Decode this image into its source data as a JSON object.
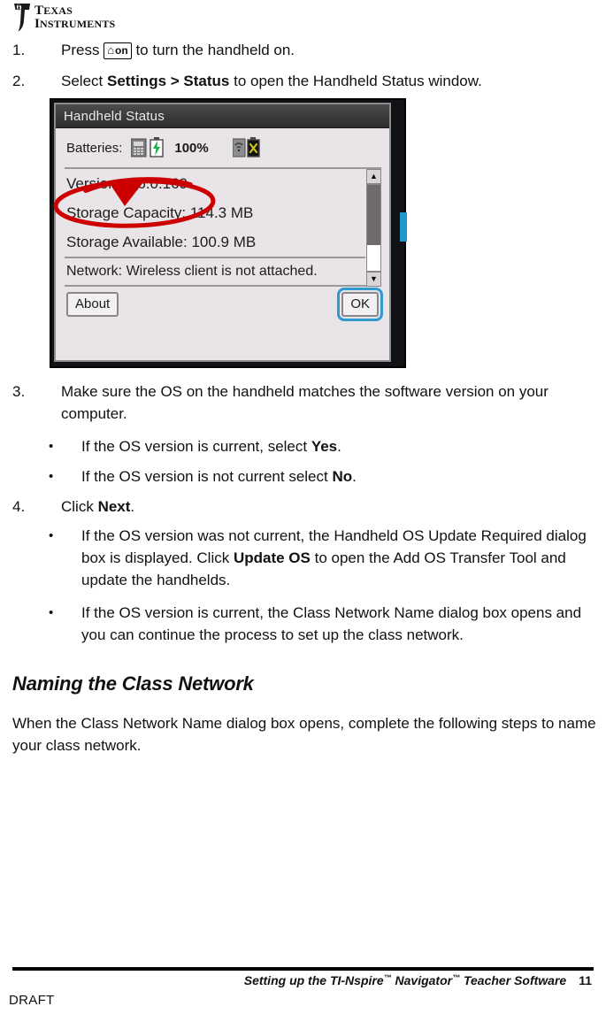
{
  "logo": {
    "line1": "TEXAS",
    "line2": "INSTRUMENTS",
    "alt": "texas-instruments-logo"
  },
  "steps": [
    {
      "num": "1.",
      "pre": "Press ",
      "key": "on",
      "post": " to turn the handheld on."
    },
    {
      "num": "2.",
      "pre": "Select ",
      "bold": "Settings > Status",
      "post": " to open the Handheld Status window."
    },
    {
      "num": "3.",
      "text": "Make sure the OS on the handheld matches the software version on your computer."
    },
    {
      "num": "4.",
      "pre": "Click ",
      "bold": "Next",
      "post": "."
    }
  ],
  "bullets_after_step3": [
    {
      "dot": "•",
      "pre": "If the OS version is current, select ",
      "bold": "Yes",
      "post": "."
    },
    {
      "dot": "•",
      "pre": "If the OS version is not current select ",
      "bold": "No",
      "post": "."
    }
  ],
  "bullets_after_step4": [
    {
      "dot": "•",
      "pre": "If the OS version was not current, the Handheld OS Update Required dialog box is displayed. Click ",
      "bold": "Update OS",
      "post": " to open the Add OS Transfer Tool and update the handhelds."
    },
    {
      "dot": "•",
      "pre": "If the OS version is current, the Class Network Name dialog box opens and you can continue the process to set up the class network.",
      "bold": "",
      "post": ""
    }
  ],
  "section": {
    "heading": "Naming the Class Network",
    "paragraph": "When the Class Network Name dialog box opens, complete the following steps to name your class network."
  },
  "handheld_dialog": {
    "title": "Handheld Status",
    "batteries_label": "Batteries:",
    "battery_percent": "100%",
    "battery_icon_1": "rechargeable-battery-charged-icon",
    "battery_icon_2": "aaa-battery-absent-icon",
    "lines": [
      "Version: 3.6.0.169",
      "Storage Capacity: 114.3 MB",
      "Storage Available: 100.9 MB",
      "Network: Wireless client is not attached."
    ],
    "scroll_up_icon": "▲",
    "scroll_down_icon": "▼",
    "about_button": "About",
    "ok_button": "OK",
    "annotation": {
      "type": "red-ellipse-with-arrow",
      "target": "Version: 3.6.0.169",
      "color": "#cc0000"
    },
    "accent_color": "#2f9bd0"
  },
  "footer": {
    "title": "Setting up the TI-Nspire™ Navigator™ Teacher Software",
    "page_number": "11",
    "draft": "DRAFT"
  }
}
